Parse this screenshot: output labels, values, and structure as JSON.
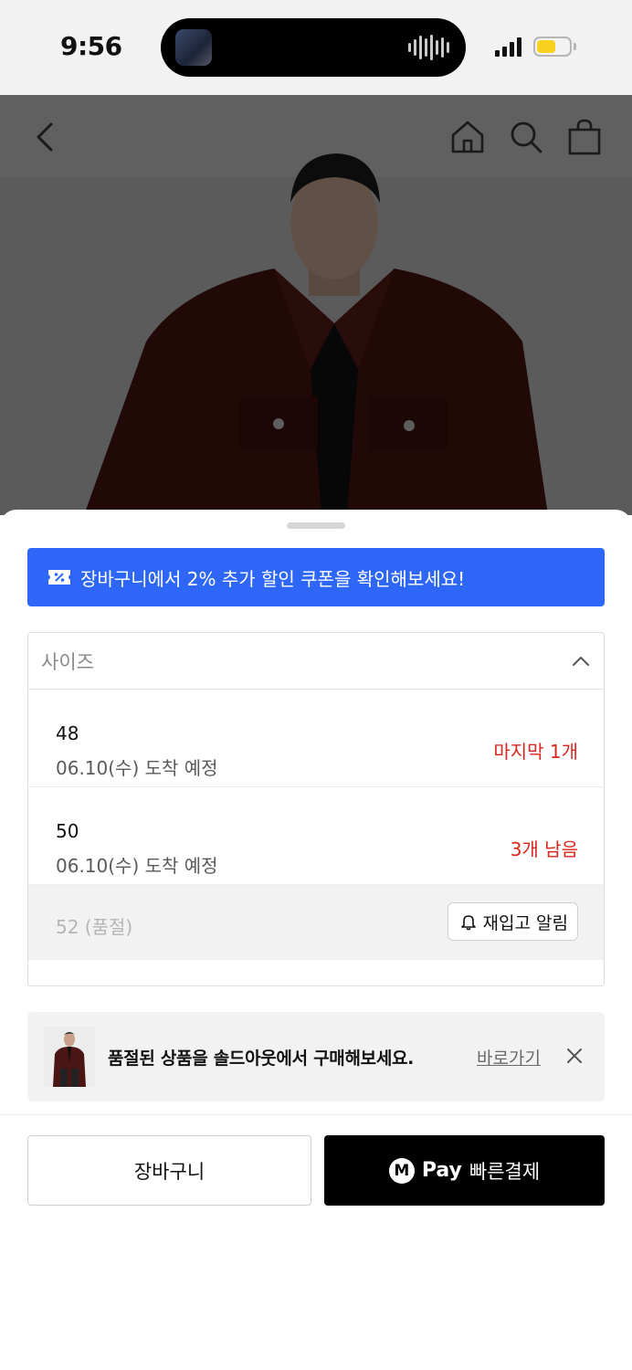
{
  "status_bar": {
    "time": "9:56"
  },
  "nav": {
    "back_icon": "chevron-left-icon",
    "home_icon": "home-icon",
    "search_icon": "search-icon",
    "bag_icon": "shopping-bag-icon"
  },
  "coupon_banner": {
    "text": "장바구니에서 2% 추가 할인 쿠폰을 확인해보세요!",
    "color": "#2e67f8"
  },
  "size_selector": {
    "label": "사이즈",
    "options": [
      {
        "size": "48",
        "delivery": "06.10(수) 도착 예정",
        "stock": "마지막 1개"
      },
      {
        "size": "50",
        "delivery": "06.10(수) 도착 예정",
        "stock": "3개 남음"
      }
    ],
    "soldout_option": {
      "label": "52 (품절)",
      "restock_button": "재입고 알림"
    },
    "stock_color": "#d9261c"
  },
  "soldout_banner": {
    "text": "품절된 상품을 솔드아웃에서 구매해보세요.",
    "link": "바로가기"
  },
  "actions": {
    "cart_label": "장바구니",
    "pay_badge": "M",
    "pay_word": "Pay",
    "pay_label": "빠른결제"
  }
}
